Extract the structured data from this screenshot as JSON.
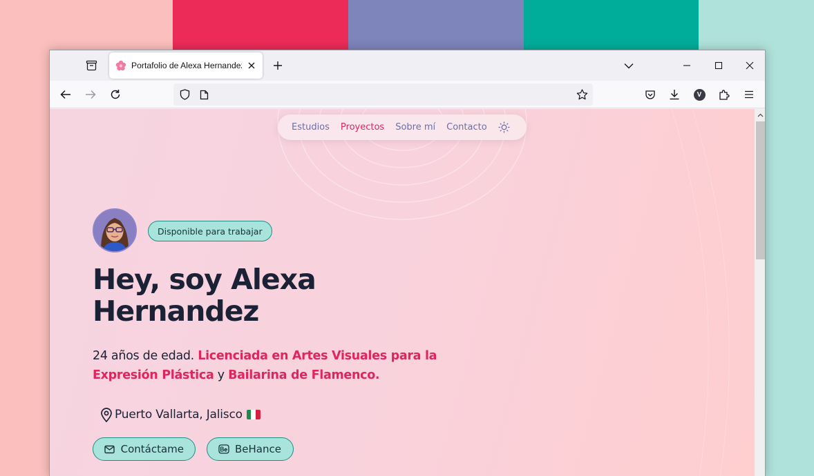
{
  "browser": {
    "tab_title": "Portafolio de Alexa Hernandez",
    "url": ""
  },
  "site_nav": {
    "items": [
      {
        "label": "Estudios",
        "active": false
      },
      {
        "label": "Proyectos",
        "active": true
      },
      {
        "label": "Sobre mí",
        "active": false
      },
      {
        "label": "Contacto",
        "active": false
      }
    ]
  },
  "hero": {
    "badge": "Disponible para trabajar",
    "title_line1": "Hey, soy Alexa",
    "title_line2": "Hernandez",
    "desc_plain1": "24 años de edad. ",
    "desc_hl1": "Licenciada en Artes Visuales para la Expresión Plástica",
    "desc_plain2": " y ",
    "desc_hl2": "Bailarina de Flamenco.",
    "location": "Puerto Vallarta, Jalisco",
    "buttons": {
      "contact": "Contáctame",
      "behance": "BeHance"
    }
  },
  "colors": {
    "accent": "#e0245e",
    "nav_text": "#6b6fa8",
    "badge_bg": "#a8e3dc",
    "badge_border": "#1f8e82",
    "heading": "#1b2236"
  },
  "icons": {
    "tab_favicon": "flower-icon",
    "location": "map-pin-icon",
    "contact": "mail-icon",
    "behance": "behance-icon",
    "theme": "sun-icon"
  }
}
